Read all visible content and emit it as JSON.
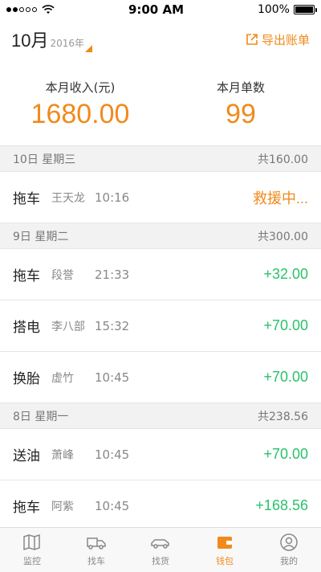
{
  "status_bar": {
    "time": "9:00 AM",
    "battery": "100%"
  },
  "header": {
    "month": "10月",
    "year": "2016年",
    "export_label": "导出账单"
  },
  "summary": {
    "income_label": "本月收入(元)",
    "income_value": "1680.00",
    "orders_label": "本月单数",
    "orders_value": "99"
  },
  "days": [
    {
      "date": "10日 星期三",
      "total": "共160.00",
      "rows": [
        {
          "service": "拖车",
          "person": "王天龙",
          "time": "10:16",
          "amount": "救援中..."
        }
      ]
    },
    {
      "date": "9日 星期二",
      "total": "共300.00",
      "rows": [
        {
          "service": "拖车",
          "person": "段誉",
          "time": "21:33",
          "amount": "+32.00"
        },
        {
          "service": "搭电",
          "person": "李八部",
          "time": "15:32",
          "amount": "+70.00"
        },
        {
          "service": "换胎",
          "person": "虚竹",
          "time": "10:45",
          "amount": "+70.00"
        }
      ]
    },
    {
      "date": "8日 星期一",
      "total": "共238.56",
      "rows": [
        {
          "service": "送油",
          "person": "萧峰",
          "time": "10:45",
          "amount": "+70.00"
        },
        {
          "service": "拖车",
          "person": "阿紫",
          "time": "10:45",
          "amount": "+168.56"
        }
      ]
    }
  ],
  "tabs": [
    {
      "label": "监控",
      "icon": "map-icon"
    },
    {
      "label": "找车",
      "icon": "truck-icon"
    },
    {
      "label": "找货",
      "icon": "car-icon"
    },
    {
      "label": "钱包",
      "icon": "wallet-icon"
    },
    {
      "label": "我的",
      "icon": "user-icon"
    }
  ],
  "colors": {
    "accent": "#f08a1c",
    "positive": "#29c26b"
  }
}
